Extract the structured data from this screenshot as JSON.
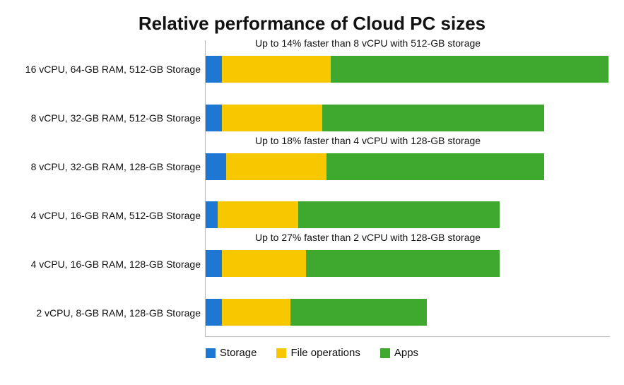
{
  "chart_data": {
    "type": "bar",
    "orientation": "horizontal_stacked",
    "title": "Relative performance of Cloud PC sizes",
    "xlabel": "",
    "ylabel": "",
    "xlim": [
      0,
      100
    ],
    "categories": [
      "16 vCPU, 64-GB RAM, 512-GB Storage",
      "8 vCPU, 32-GB RAM, 512-GB Storage",
      "8 vCPU, 32-GB RAM, 128-GB Storage",
      "4 vCPU, 16-GB RAM, 512-GB Storage",
      "4 vCPU, 16-GB RAM, 128-GB Storage",
      "2 vCPU, 8-GB RAM, 128-GB Storage"
    ],
    "series": [
      {
        "name": "Storage",
        "color": "#1f77d4",
        "values": [
          4,
          4,
          5,
          3,
          4,
          4
        ]
      },
      {
        "name": "File operations",
        "color": "#f7c700",
        "values": [
          27,
          25,
          25,
          20,
          21,
          17
        ]
      },
      {
        "name": "Apps",
        "color": "#3ea92e",
        "values": [
          69,
          55,
          54,
          50,
          48,
          34
        ]
      }
    ],
    "annotations": [
      {
        "row": 0,
        "text": "Up to 14% faster than 8 vCPU with 512-GB storage"
      },
      {
        "row": 2,
        "text": "Up to 18% faster than 4 vCPU with 128-GB storage"
      },
      {
        "row": 4,
        "text": "Up to 27% faster than 2 vCPU with 128-GB storage"
      }
    ],
    "legend": {
      "position": "bottom",
      "items": [
        {
          "name": "Storage",
          "color": "#1f77d4"
        },
        {
          "name": "File operations",
          "color": "#f7c700"
        },
        {
          "name": "Apps",
          "color": "#3ea92e"
        }
      ]
    }
  }
}
